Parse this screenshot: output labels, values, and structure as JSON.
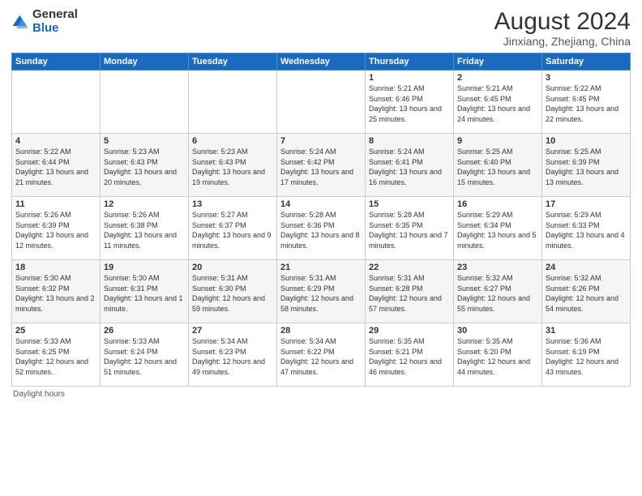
{
  "logo": {
    "general": "General",
    "blue": "Blue"
  },
  "title": "August 2024",
  "subtitle": "Jinxiang, Zhejiang, China",
  "days_of_week": [
    "Sunday",
    "Monday",
    "Tuesday",
    "Wednesday",
    "Thursday",
    "Friday",
    "Saturday"
  ],
  "weeks": [
    [
      {
        "day": "",
        "info": ""
      },
      {
        "day": "",
        "info": ""
      },
      {
        "day": "",
        "info": ""
      },
      {
        "day": "",
        "info": ""
      },
      {
        "day": "1",
        "info": "Sunrise: 5:21 AM\nSunset: 6:46 PM\nDaylight: 13 hours and 25 minutes."
      },
      {
        "day": "2",
        "info": "Sunrise: 5:21 AM\nSunset: 6:45 PM\nDaylight: 13 hours and 24 minutes."
      },
      {
        "day": "3",
        "info": "Sunrise: 5:22 AM\nSunset: 6:45 PM\nDaylight: 13 hours and 22 minutes."
      }
    ],
    [
      {
        "day": "4",
        "info": "Sunrise: 5:22 AM\nSunset: 6:44 PM\nDaylight: 13 hours and 21 minutes."
      },
      {
        "day": "5",
        "info": "Sunrise: 5:23 AM\nSunset: 6:43 PM\nDaylight: 13 hours and 20 minutes."
      },
      {
        "day": "6",
        "info": "Sunrise: 5:23 AM\nSunset: 6:43 PM\nDaylight: 13 hours and 19 minutes."
      },
      {
        "day": "7",
        "info": "Sunrise: 5:24 AM\nSunset: 6:42 PM\nDaylight: 13 hours and 17 minutes."
      },
      {
        "day": "8",
        "info": "Sunrise: 5:24 AM\nSunset: 6:41 PM\nDaylight: 13 hours and 16 minutes."
      },
      {
        "day": "9",
        "info": "Sunrise: 5:25 AM\nSunset: 6:40 PM\nDaylight: 13 hours and 15 minutes."
      },
      {
        "day": "10",
        "info": "Sunrise: 5:25 AM\nSunset: 6:39 PM\nDaylight: 13 hours and 13 minutes."
      }
    ],
    [
      {
        "day": "11",
        "info": "Sunrise: 5:26 AM\nSunset: 6:39 PM\nDaylight: 13 hours and 12 minutes."
      },
      {
        "day": "12",
        "info": "Sunrise: 5:26 AM\nSunset: 6:38 PM\nDaylight: 13 hours and 11 minutes."
      },
      {
        "day": "13",
        "info": "Sunrise: 5:27 AM\nSunset: 6:37 PM\nDaylight: 13 hours and 9 minutes."
      },
      {
        "day": "14",
        "info": "Sunrise: 5:28 AM\nSunset: 6:36 PM\nDaylight: 13 hours and 8 minutes."
      },
      {
        "day": "15",
        "info": "Sunrise: 5:28 AM\nSunset: 6:35 PM\nDaylight: 13 hours and 7 minutes."
      },
      {
        "day": "16",
        "info": "Sunrise: 5:29 AM\nSunset: 6:34 PM\nDaylight: 13 hours and 5 minutes."
      },
      {
        "day": "17",
        "info": "Sunrise: 5:29 AM\nSunset: 6:33 PM\nDaylight: 13 hours and 4 minutes."
      }
    ],
    [
      {
        "day": "18",
        "info": "Sunrise: 5:30 AM\nSunset: 6:32 PM\nDaylight: 13 hours and 2 minutes."
      },
      {
        "day": "19",
        "info": "Sunrise: 5:30 AM\nSunset: 6:31 PM\nDaylight: 13 hours and 1 minute."
      },
      {
        "day": "20",
        "info": "Sunrise: 5:31 AM\nSunset: 6:30 PM\nDaylight: 12 hours and 59 minutes."
      },
      {
        "day": "21",
        "info": "Sunrise: 5:31 AM\nSunset: 6:29 PM\nDaylight: 12 hours and 58 minutes."
      },
      {
        "day": "22",
        "info": "Sunrise: 5:31 AM\nSunset: 6:28 PM\nDaylight: 12 hours and 57 minutes."
      },
      {
        "day": "23",
        "info": "Sunrise: 5:32 AM\nSunset: 6:27 PM\nDaylight: 12 hours and 55 minutes."
      },
      {
        "day": "24",
        "info": "Sunrise: 5:32 AM\nSunset: 6:26 PM\nDaylight: 12 hours and 54 minutes."
      }
    ],
    [
      {
        "day": "25",
        "info": "Sunrise: 5:33 AM\nSunset: 6:25 PM\nDaylight: 12 hours and 52 minutes."
      },
      {
        "day": "26",
        "info": "Sunrise: 5:33 AM\nSunset: 6:24 PM\nDaylight: 12 hours and 51 minutes."
      },
      {
        "day": "27",
        "info": "Sunrise: 5:34 AM\nSunset: 6:23 PM\nDaylight: 12 hours and 49 minutes."
      },
      {
        "day": "28",
        "info": "Sunrise: 5:34 AM\nSunset: 6:22 PM\nDaylight: 12 hours and 47 minutes."
      },
      {
        "day": "29",
        "info": "Sunrise: 5:35 AM\nSunset: 6:21 PM\nDaylight: 12 hours and 46 minutes."
      },
      {
        "day": "30",
        "info": "Sunrise: 5:35 AM\nSunset: 6:20 PM\nDaylight: 12 hours and 44 minutes."
      },
      {
        "day": "31",
        "info": "Sunrise: 5:36 AM\nSunset: 6:19 PM\nDaylight: 12 hours and 43 minutes."
      }
    ]
  ],
  "footer": "Daylight hours"
}
